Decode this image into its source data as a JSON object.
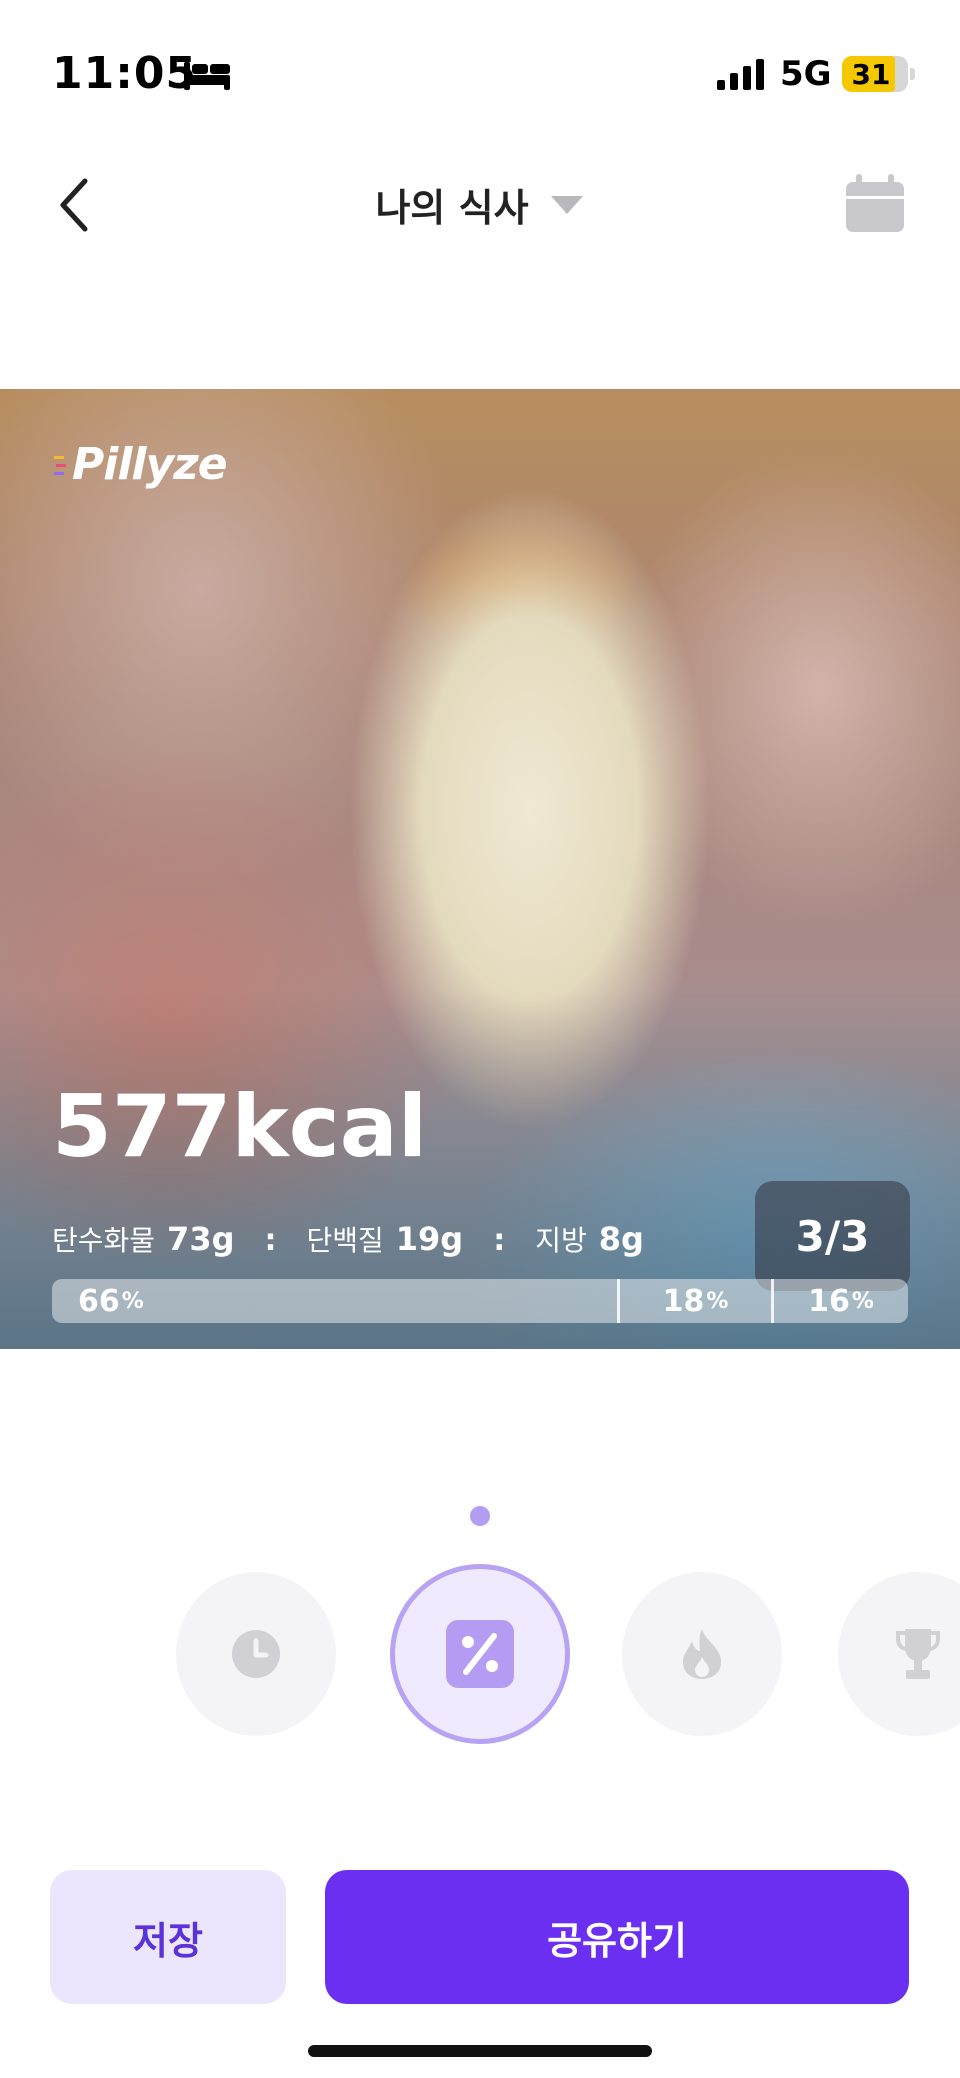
{
  "status_bar": {
    "time": "11:05",
    "network": "5G",
    "battery_level": "31",
    "battery_fraction": 0.31,
    "battery_color": "#f5c800",
    "icons": [
      "bed-icon",
      "signal-icon",
      "battery-icon"
    ]
  },
  "header": {
    "title": "나의 식사",
    "back_icon": "chevron-left-icon",
    "dropdown_icon": "caret-down-icon",
    "calendar_icon": "calendar-icon"
  },
  "meal_card": {
    "brand": "Pillyze",
    "calories": "577kcal",
    "macros": [
      {
        "name": "탄수화물",
        "value": "73g"
      },
      {
        "name": "단백질",
        "value": "19g"
      },
      {
        "name": "지방",
        "value": "8g"
      }
    ],
    "separator": ":",
    "page_indicator": "3/3",
    "ratio": [
      {
        "key": "carb",
        "value": "66",
        "symbol": "%",
        "fraction": 0.66
      },
      {
        "key": "protein",
        "value": "18",
        "symbol": "%",
        "fraction": 0.18
      },
      {
        "key": "fat",
        "value": "16",
        "symbol": "%",
        "fraction": 0.16
      }
    ]
  },
  "style_modes": {
    "icons": [
      "clock-icon",
      "percent-icon",
      "fire-icon",
      "trophy-icon"
    ],
    "selected": "percent-icon",
    "accent": "#b49cf3"
  },
  "actions": {
    "save_label": "저장",
    "share_label": "공유하기",
    "primary_color": "#6a2ff0"
  }
}
